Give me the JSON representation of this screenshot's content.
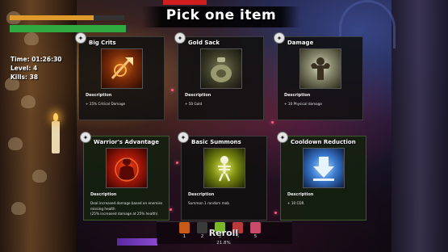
{
  "screen": {
    "title": "Pick one item"
  },
  "hud": {
    "time_label": "Time: 01:26:30",
    "level_label": "Level: 4",
    "kills_label": "Kills: 38",
    "xp_fraction": 0.73,
    "health_fraction": 0.98,
    "colors": {
      "xp": "#e09a2c",
      "health": "#2faa3e"
    }
  },
  "description_heading": "Description",
  "cards": [
    {
      "name": "Big Crits",
      "description": "+ 25% Critical Damage",
      "icon": "crit-axe-icon",
      "accent": "#d06a18"
    },
    {
      "name": "Gold Sack",
      "description": "+ 50 Gold",
      "icon": "gold-sack-icon",
      "accent": "#7a7a56"
    },
    {
      "name": "Damage",
      "description": "+ 10 Physical damage",
      "icon": "flexing-warrior-icon",
      "accent": "#dcdcc8"
    },
    {
      "name": "Warrior's Advantage",
      "description_lines": [
        "Deal increased damage based on enemies missing health",
        "(25% increased damage at 25% health)"
      ],
      "icon": "warrior-fire-icon",
      "accent": "#ff4a18"
    },
    {
      "name": "Basic Summons",
      "description": "Summon 1 random mob",
      "icon": "skeleton-summon-icon",
      "accent": "#e0ea60"
    },
    {
      "name": "Cooldown Reduction",
      "description": "+ 10 CDR",
      "icon": "down-arrow-icon",
      "accent": "#3a7ad0"
    }
  ],
  "bottom": {
    "slots": [
      {
        "number": "1",
        "color": "#c85a18"
      },
      {
        "number": "2",
        "color": "#3a3a3a"
      },
      {
        "number": "3",
        "color": "#7ab82a"
      },
      {
        "number": "4",
        "color": "#b83a3a"
      },
      {
        "number": "5",
        "color": "#c84a6a"
      }
    ],
    "reroll_label": "Reroll",
    "reroll_percent": "21.8%"
  }
}
